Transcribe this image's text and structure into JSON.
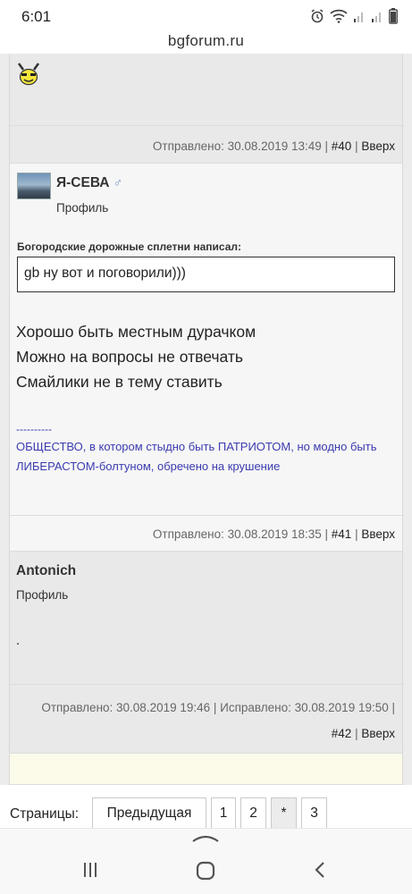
{
  "status_bar": {
    "time": "6:01",
    "icons": [
      "alarm-icon",
      "wifi-icon",
      "signal-icon",
      "signal-icon",
      "battery-icon"
    ]
  },
  "browser": {
    "url": "bgforum.ru"
  },
  "posts": [
    {
      "smiley": "smiley-icon",
      "sent": "Отправлено: 30.08.2019 13:49 |",
      "number": "#40",
      "sep": "|",
      "up": "Вверх"
    },
    {
      "author": "Я-СЕВА",
      "gender": "♂",
      "profile": "Профиль",
      "quote_caption": "Богородские дорожные сплетни написал:",
      "quote_text": "gb ну вот и поговорили)))",
      "lines": [
        "Хорошо быть местным дурачком",
        "Можно на вопросы не отвечать",
        "Смайлики не в тему ставить"
      ],
      "signature_dashes": "----------",
      "signature": "ОБЩЕСТВО, в котором стыдно быть ПАТРИОТОМ, но модно быть ЛИБЕРАСТОМ-болтуном, обречено на крушение",
      "sent": "Отправлено: 30.08.2019 18:35 |",
      "number": "#41",
      "sep": "|",
      "up": "Вверх"
    },
    {
      "author": "Antonich",
      "profile": "Профиль",
      "text": ".",
      "sent": "Отправлено: 30.08.2019 19:46 | Исправлено: 30.08.2019 19:50 |",
      "number": "#42",
      "sep": "|",
      "up": "Вверх"
    }
  ],
  "pagination": {
    "label": "Страницы:",
    "prev": "Предыдущая",
    "pages": [
      "1",
      "2",
      "*",
      "3"
    ]
  }
}
